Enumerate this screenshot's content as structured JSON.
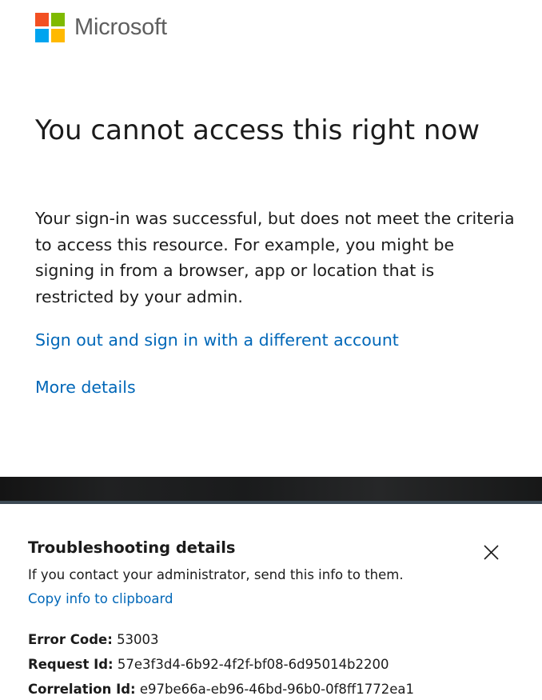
{
  "brand": {
    "name": "Microsoft",
    "logo_colors": [
      "#f25022",
      "#7fba00",
      "#00a4ef",
      "#ffb900"
    ]
  },
  "main": {
    "title": "You cannot access this right now",
    "description": "Your sign-in was successful, but does not meet the criteria to access this resource. For example, you might be signing in from a browser, app or location that is restricted by your admin.",
    "sign_out_link": "Sign out and sign in with a different account",
    "more_details_link": "More details"
  },
  "troubleshooting": {
    "title": "Troubleshooting details",
    "close_icon": "close-icon",
    "subtitle": "If you contact your administrator, send this info to them.",
    "copy_link": "Copy info to clipboard",
    "details": [
      {
        "label": "Error Code:",
        "value": "53003"
      },
      {
        "label": "Request Id:",
        "value": "57e3f3d4-6b92-4f2f-bf08-6d95014b2200"
      },
      {
        "label": "Correlation Id:",
        "value": "e97be66a-eb96-46bd-96b0-0f8ff1772ea1"
      }
    ]
  },
  "colors": {
    "link": "#0067b8",
    "text": "#1b1b1b",
    "brand_text": "#5e5e5e"
  }
}
